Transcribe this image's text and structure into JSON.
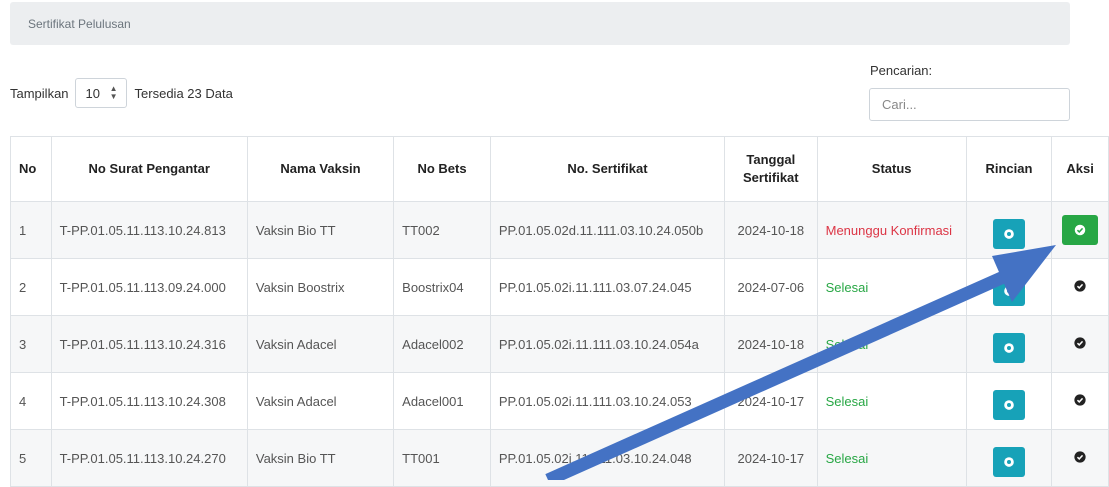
{
  "breadcrumb": {
    "title": "Sertifikat Pelulusan"
  },
  "controls": {
    "show_label": "Tampilkan",
    "page_size": "10",
    "available_text": "Tersedia 23 Data",
    "search_label": "Pencarian:",
    "search_placeholder": "Cari..."
  },
  "table": {
    "headers": {
      "no": "No",
      "surat": "No Surat Pengantar",
      "vaksin": "Nama Vaksin",
      "bets": "No Bets",
      "sertifikat": "No. Sertifikat",
      "tanggal_line1": "Tanggal",
      "tanggal_line2": "Sertifikat",
      "status": "Status",
      "rincian": "Rincian",
      "aksi": "Aksi"
    },
    "rows": [
      {
        "no": "1",
        "surat": "T-PP.01.05.11.113.10.24.813",
        "vaksin": "Vaksin Bio TT",
        "bets": "TT002",
        "sertifikat": "PP.01.05.02d.11.111.03.10.24.050b",
        "tanggal": "2024-10-18",
        "status": "Menunggu Konfirmasi"
      },
      {
        "no": "2",
        "surat": "T-PP.01.05.11.113.09.24.000",
        "vaksin": "Vaksin Boostrix",
        "bets": "Boostrix04",
        "sertifikat": "PP.01.05.02i.11.111.03.07.24.045",
        "tanggal": "2024-07-06",
        "status": "Selesai"
      },
      {
        "no": "3",
        "surat": "T-PP.01.05.11.113.10.24.316",
        "vaksin": "Vaksin Adacel",
        "bets": "Adacel002",
        "sertifikat": "PP.01.05.02i.11.111.03.10.24.054a",
        "tanggal": "2024-10-18",
        "status": "Selesai"
      },
      {
        "no": "4",
        "surat": "T-PP.01.05.11.113.10.24.308",
        "vaksin": "Vaksin Adacel",
        "bets": "Adacel001",
        "sertifikat": "PP.01.05.02i.11.111.03.10.24.053",
        "tanggal": "2024-10-17",
        "status": "Selesai"
      },
      {
        "no": "5",
        "surat": "T-PP.01.05.11.113.10.24.270",
        "vaksin": "Vaksin Bio TT",
        "bets": "TT001",
        "sertifikat": "PP.01.05.02i.11.111.03.10.24.048",
        "tanggal": "2024-10-17",
        "status": "Selesai"
      }
    ]
  },
  "colors": {
    "info_button": "#17a2b8",
    "success_button": "#28a745",
    "status_waiting": "#dc3545",
    "status_done": "#28a745",
    "annotation_arrow": "#4472c4"
  },
  "icons": {
    "rincian": "eye-icon",
    "aksi_pending": "check-circle-icon",
    "aksi_done": "check-circle-icon",
    "annotation": "arrow-annotation"
  }
}
